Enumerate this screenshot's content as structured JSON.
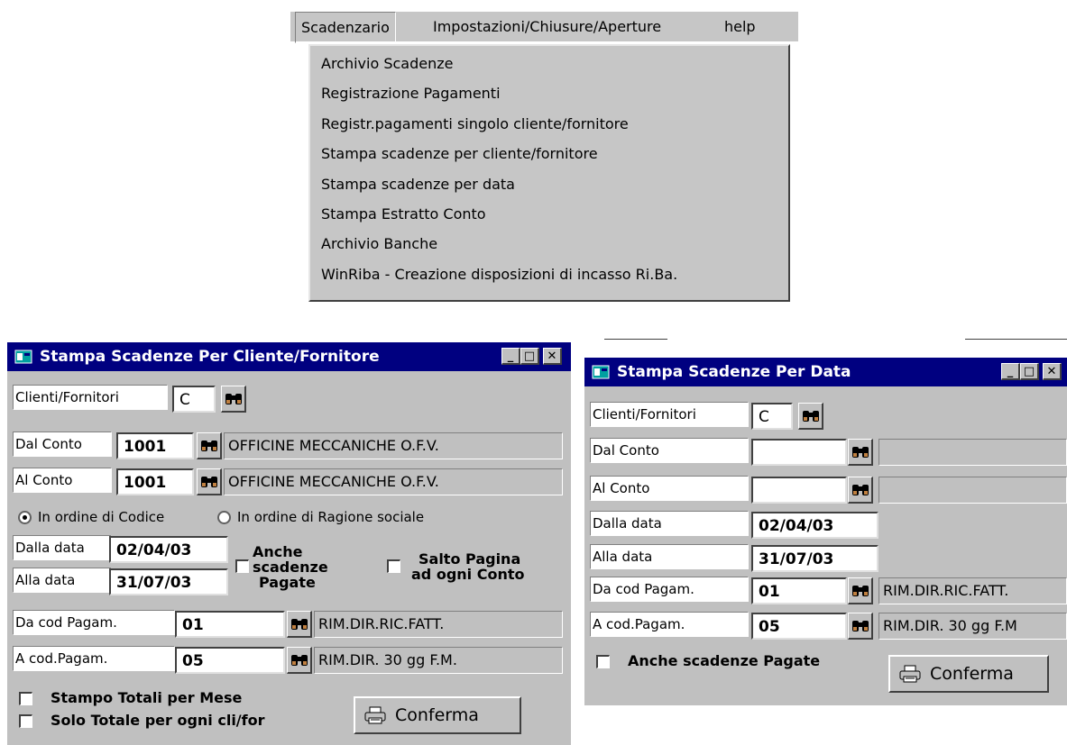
{
  "menu": {
    "items": [
      "Scadenzario",
      "Impostazioni/Chiusure/Aperture",
      "help"
    ],
    "dropdown": [
      "Archivio Scadenze",
      "Registrazione Pagamenti",
      "Registr.pagamenti singolo cliente/fornitore",
      "Stampa scadenze per cliente/fornitore",
      "Stampa scadenze per data",
      "Stampa Estratto Conto",
      "Archivio Banche",
      "WinRiba - Creazione disposizioni di incasso Ri.Ba."
    ]
  },
  "win1": {
    "title": "Stampa Scadenze Per Cliente/Fornitore",
    "lbl_clienti": "Clienti/Fornitori",
    "val_clienti": "C",
    "lbl_dal_conto": "Dal Conto",
    "val_dal_conto": "1001",
    "desc_dal_conto": "OFFICINE MECCANICHE O.F.V.",
    "lbl_al_conto": "Al Conto",
    "val_al_conto": "1001",
    "desc_al_conto": "OFFICINE MECCANICHE O.F.V.",
    "radio_codice": "In ordine di Codice",
    "radio_ragione": "In ordine di Ragione sociale",
    "selected_order": "codice",
    "lbl_dalla_data": "Dalla data",
    "val_dalla_data": "02/04/03",
    "lbl_alla_data": "Alla data",
    "val_alla_data": "31/07/03",
    "chk_anche_l1": "Anche",
    "chk_anche_l2": "scadenze",
    "chk_anche_l3": "Pagate",
    "chk_salto_l1": "Salto Pagina",
    "chk_salto_l2": "ad ogni Conto",
    "lbl_da_cod": "Da cod Pagam.",
    "val_da_cod": "01",
    "desc_da_cod": "RIM.DIR.RIC.FATT.",
    "lbl_a_cod": "A cod.Pagam.",
    "val_a_cod": "05",
    "desc_a_cod": "RIM.DIR. 30 gg F.M.",
    "chk_totali_mese": "Stampo Totali per Mese",
    "chk_solo_totale": "Solo Totale per ogni cli/for",
    "confirm": "Conferma"
  },
  "win2": {
    "title": "Stampa Scadenze Per Data",
    "lbl_clienti": "Clienti/Fornitori",
    "val_clienti": "C",
    "lbl_dal_conto": "Dal Conto",
    "val_dal_conto": "",
    "desc_dal_conto": "",
    "lbl_al_conto": "Al Conto",
    "val_al_conto": "",
    "desc_al_conto": "",
    "lbl_dalla_data": "Dalla data",
    "val_dalla_data": "02/04/03",
    "lbl_alla_data": "Alla data",
    "val_alla_data": "31/07/03",
    "lbl_da_cod": "Da cod Pagam.",
    "val_da_cod": "01",
    "desc_da_cod": "RIM.DIR.RIC.FATT.",
    "lbl_a_cod": "A cod.Pagam.",
    "val_a_cod": "05",
    "desc_a_cod": "RIM.DIR. 30 gg F.M",
    "chk_anche": "Anche scadenze Pagate",
    "confirm": "Conferma"
  },
  "window_buttons": {
    "minimize": "_",
    "maximize": "□",
    "close": "✕"
  }
}
